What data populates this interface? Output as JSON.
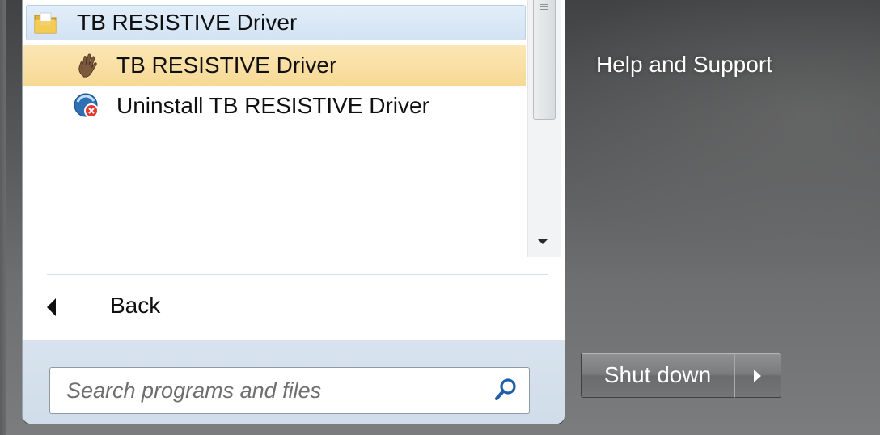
{
  "start_menu": {
    "programs": {
      "folder": {
        "label": "TB RESISTIVE Driver",
        "icon": "folder-icon"
      },
      "items": [
        {
          "label": "TB RESISTIVE Driver",
          "icon": "hand-icon",
          "highlighted": true
        },
        {
          "label": "Uninstall  TB RESISTIVE Driver",
          "icon": "uninstall-icon",
          "highlighted": false
        }
      ]
    },
    "back": {
      "label": "Back",
      "icon": "back-arrow-icon"
    },
    "search": {
      "placeholder": "Search programs and files",
      "value": "",
      "icon": "search-icon"
    }
  },
  "right_pane": {
    "links": [
      {
        "label": "Help and Support"
      }
    ],
    "shutdown": {
      "label": "Shut down",
      "menu_icon": "arrow-right-icon"
    }
  }
}
